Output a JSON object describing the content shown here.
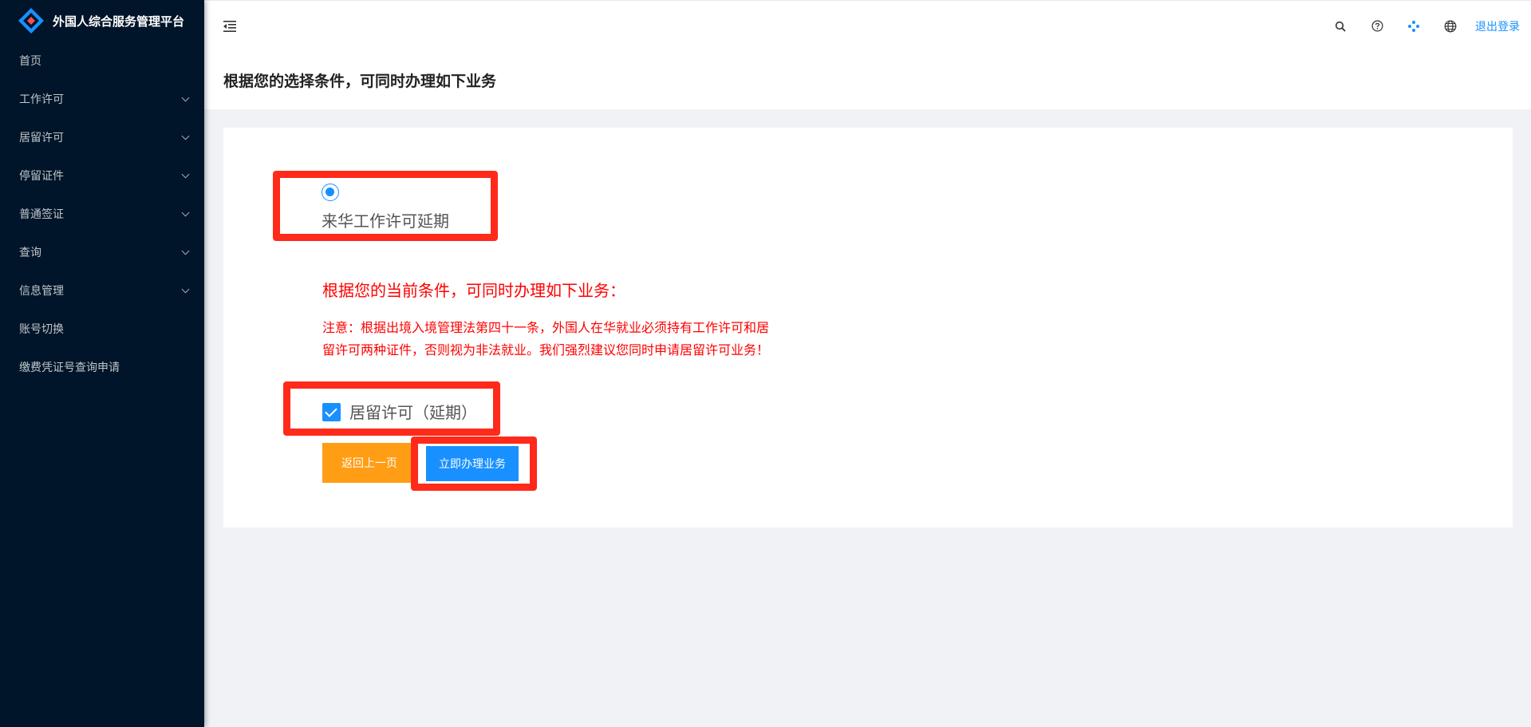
{
  "app": {
    "title": "外国人综合服务管理平台"
  },
  "sidebar": {
    "items": [
      {
        "label": "首页",
        "has_children": false
      },
      {
        "label": "工作许可",
        "has_children": true
      },
      {
        "label": "居留许可",
        "has_children": true
      },
      {
        "label": "停留证件",
        "has_children": true
      },
      {
        "label": "普通签证",
        "has_children": true
      },
      {
        "label": "查询",
        "has_children": true
      },
      {
        "label": "信息管理",
        "has_children": true
      },
      {
        "label": "账号切换",
        "has_children": false
      },
      {
        "label": "缴费凭证号查询申请",
        "has_children": false
      }
    ]
  },
  "header": {
    "icons": [
      "menu-fold-icon",
      "search-icon",
      "question-icon",
      "apps-icon",
      "globe-icon"
    ],
    "logout_label": "退出登录"
  },
  "page": {
    "title": "根据您的选择条件，可同时办理如下业务"
  },
  "form": {
    "radio_option": {
      "label": "来华工作许可延期",
      "selected": true
    },
    "notice_title": "根据您的当前条件，可同时办理如下业务：",
    "notice_text": "注意：根据出境入境管理法第四十一条，外国人在华就业必须持有工作许可和居留许可两种证件，否则视为非法就业。我们强烈建议您同时申请居留许可业务！",
    "checkbox_option": {
      "label": "居留许可（延期）",
      "checked": true
    },
    "back_button": "返回上一页",
    "submit_button": "立即办理业务"
  },
  "colors": {
    "sidebar_bg": "#001529",
    "primary": "#1890ff",
    "warning_button": "#ff9d14",
    "notice_text": "#ff0000",
    "highlight_frame": "#ff2a1a"
  }
}
